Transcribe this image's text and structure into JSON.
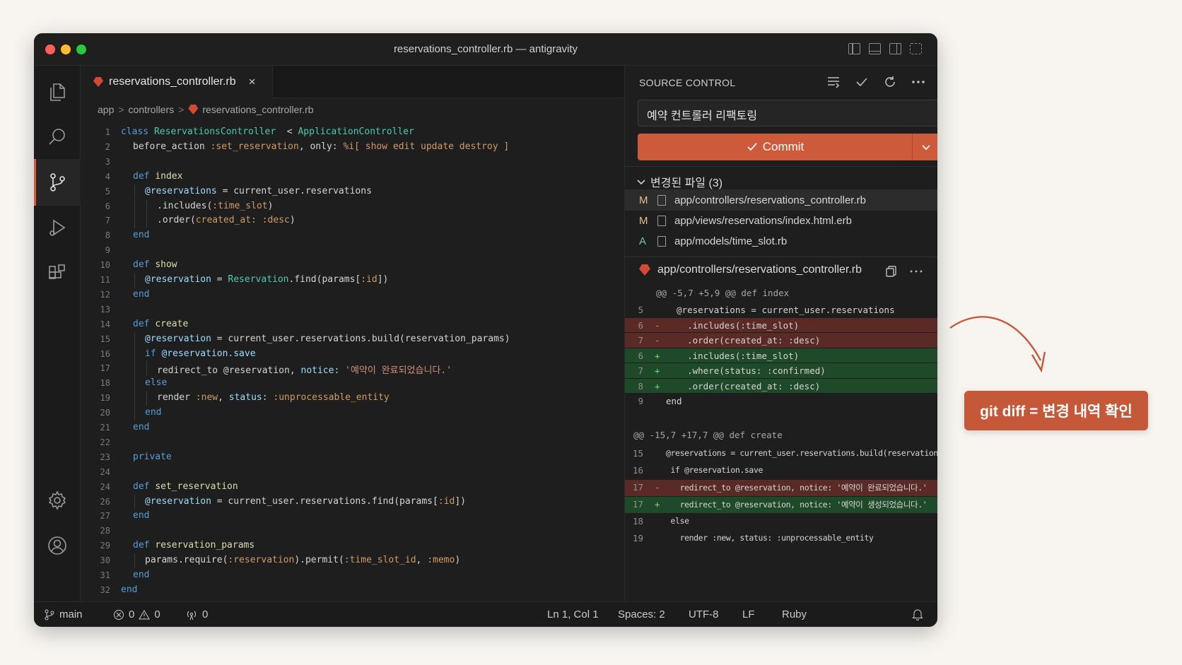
{
  "window": {
    "title": "reservations_controller.rb — antigravity"
  },
  "tab": {
    "label": "reservations_controller.rb",
    "close": "×"
  },
  "breadcrumb": {
    "parts": [
      "app",
      "controllers",
      "reservations_controller.rb"
    ],
    "sep": ">"
  },
  "editor": {
    "lines": [
      {
        "n": "1",
        "indent": 0,
        "tokens": [
          [
            "kw",
            "class "
          ],
          [
            "cls",
            "ReservationsController"
          ],
          [
            "",
            "  < "
          ],
          [
            "cls",
            "ApplicationController"
          ]
        ]
      },
      {
        "n": "2",
        "indent": 1,
        "tokens": [
          [
            "",
            "before_action "
          ],
          [
            "sym",
            ":set_reservation"
          ],
          [
            "",
            ", only: "
          ],
          [
            "sym",
            "%i[ show edit update destroy ]"
          ]
        ]
      },
      {
        "n": "3",
        "indent": 0,
        "tokens": []
      },
      {
        "n": "4",
        "indent": 1,
        "tokens": [
          [
            "kw",
            "def "
          ],
          [
            "fn",
            "index"
          ]
        ]
      },
      {
        "n": "5",
        "indent": 2,
        "tokens": [
          [
            "iv",
            "@reservations"
          ],
          [
            "",
            " = current_user.reservations"
          ]
        ]
      },
      {
        "n": "6",
        "indent": 3,
        "tokens": [
          [
            "",
            ".includes("
          ],
          [
            "sym",
            ":time_slot"
          ],
          [
            "",
            ")"
          ]
        ]
      },
      {
        "n": "7",
        "indent": 3,
        "tokens": [
          [
            "",
            ".order("
          ],
          [
            "sym",
            "created_at: :desc"
          ],
          [
            "",
            ")"
          ]
        ]
      },
      {
        "n": "8",
        "indent": 1,
        "tokens": [
          [
            "kw",
            "end"
          ]
        ]
      },
      {
        "n": "9",
        "indent": 0,
        "tokens": []
      },
      {
        "n": "10",
        "indent": 1,
        "tokens": [
          [
            "kw",
            "def "
          ],
          [
            "fn",
            "show"
          ]
        ]
      },
      {
        "n": "11",
        "indent": 2,
        "tokens": [
          [
            "iv",
            "@reservation"
          ],
          [
            "",
            " = "
          ],
          [
            "cls",
            "Reservation"
          ],
          [
            "",
            ".find(params["
          ],
          [
            "sym",
            ":id"
          ],
          [
            "",
            "])"
          ]
        ]
      },
      {
        "n": "12",
        "indent": 1,
        "tokens": [
          [
            "kw",
            "end"
          ]
        ]
      },
      {
        "n": "13",
        "indent": 0,
        "tokens": []
      },
      {
        "n": "14",
        "indent": 1,
        "tokens": [
          [
            "kw",
            "def "
          ],
          [
            "fn",
            "create"
          ]
        ]
      },
      {
        "n": "15",
        "indent": 2,
        "tokens": [
          [
            "iv",
            "@reservation"
          ],
          [
            "",
            " = current_user.reservations.build(reservation_params)"
          ]
        ]
      },
      {
        "n": "16",
        "indent": 2,
        "tokens": [
          [
            "kw",
            "if "
          ],
          [
            "iv",
            "@reservation.save"
          ]
        ]
      },
      {
        "n": "17",
        "indent": 3,
        "tokens": [
          [
            "",
            "redirect_to @reservation, "
          ],
          [
            "iv",
            "notice: "
          ],
          [
            "str",
            "'예약이 완료되었습니다.'"
          ]
        ]
      },
      {
        "n": "18",
        "indent": 2,
        "tokens": [
          [
            "kw",
            "else"
          ]
        ]
      },
      {
        "n": "19",
        "indent": 3,
        "tokens": [
          [
            "",
            "render "
          ],
          [
            "sym",
            ":new"
          ],
          [
            "",
            ", "
          ],
          [
            "iv",
            "status: "
          ],
          [
            "sym",
            ":unprocessable_entity"
          ]
        ]
      },
      {
        "n": "20",
        "indent": 2,
        "tokens": [
          [
            "kw",
            "end"
          ]
        ]
      },
      {
        "n": "21",
        "indent": 1,
        "tokens": [
          [
            "kw",
            "end"
          ]
        ]
      },
      {
        "n": "22",
        "indent": 0,
        "tokens": []
      },
      {
        "n": "23",
        "indent": 1,
        "tokens": [
          [
            "kw",
            "private"
          ]
        ]
      },
      {
        "n": "24",
        "indent": 0,
        "tokens": []
      },
      {
        "n": "24",
        "indent": 1,
        "tokens": [
          [
            "kw",
            "def "
          ],
          [
            "fn",
            "set_reservation"
          ]
        ]
      },
      {
        "n": "26",
        "indent": 2,
        "tokens": [
          [
            "iv",
            "@reservation"
          ],
          [
            "",
            " = current_user.reservations.find(params["
          ],
          [
            "sym",
            ":id"
          ],
          [
            "",
            "])"
          ]
        ]
      },
      {
        "n": "27",
        "indent": 1,
        "tokens": [
          [
            "kw",
            "end"
          ]
        ]
      },
      {
        "n": "28",
        "indent": 0,
        "tokens": []
      },
      {
        "n": "29",
        "indent": 1,
        "tokens": [
          [
            "kw",
            "def "
          ],
          [
            "fn",
            "reservation_params"
          ]
        ]
      },
      {
        "n": "30",
        "indent": 2,
        "tokens": [
          [
            "",
            "params.require("
          ],
          [
            "sym",
            ":reservation"
          ],
          [
            "",
            ").permit("
          ],
          [
            "sym",
            ":time_slot_id"
          ],
          [
            "",
            ", "
          ],
          [
            "sym",
            ":memo"
          ],
          [
            "",
            ")"
          ]
        ]
      },
      {
        "n": "31",
        "indent": 1,
        "tokens": [
          [
            "kw",
            "end"
          ]
        ]
      },
      {
        "n": "32",
        "indent": 0,
        "tokens": [
          [
            "kw",
            "end"
          ]
        ]
      }
    ]
  },
  "scm": {
    "title": "SOURCE CONTROL",
    "message": "예약 컨트롤러 리팩토링",
    "commit_label": "Commit",
    "changes_label": "변경된 파일 (3)",
    "files": [
      {
        "status": "M",
        "path": "app/controllers/reservations_controller.rb"
      },
      {
        "status": "M",
        "path": "app/views/reservations/index.html.erb"
      },
      {
        "status": "A",
        "path": "app/models/time_slot.rb"
      }
    ],
    "diff_file": "app/controllers/reservations_controller.rb",
    "hunk1": "@@ -5,7 +5,9 @@ def index",
    "diff1": [
      {
        "n": "5",
        "type": "ctx",
        "mark": "",
        "text": "  @reservations = current_user.reservations"
      },
      {
        "n": "6",
        "type": "del",
        "mark": "-",
        "text": "    .includes(:time_slot)"
      },
      {
        "n": "7",
        "type": "del",
        "mark": "-",
        "text": "    .order(created_at: :desc)"
      },
      {
        "n": "6",
        "type": "add",
        "mark": "+",
        "text": "    .includes(:time_slot)"
      },
      {
        "n": "7",
        "type": "add",
        "mark": "+",
        "text": "    .where(status: :confirmed)"
      },
      {
        "n": "8",
        "type": "add",
        "mark": "+",
        "text": "    .order(created_at: :desc)"
      },
      {
        "n": "9",
        "type": "ctx",
        "mark": "",
        "text": "end"
      }
    ],
    "hunk2": "@@ -15,7 +17,7 @@ def create",
    "diff2": [
      {
        "n": "15",
        "type": "ctx",
        "mark": "",
        "text": "@reservations = current_user.reservations.build(reservation_params)"
      },
      {
        "n": "16",
        "type": "ctx",
        "mark": "",
        "text": " if @reservation.save"
      },
      {
        "n": "17",
        "type": "del",
        "mark": "-",
        "text": "   redirect_to @reservation, notice: '예약이 완료되었습니다.'"
      },
      {
        "n": "17",
        "type": "add",
        "mark": "+",
        "text": "   redirect_to @reservation, notice: '예약이 생성되었습니다.'"
      },
      {
        "n": "18",
        "type": "ctx",
        "mark": "",
        "text": " else"
      },
      {
        "n": "19",
        "type": "ctx",
        "mark": "",
        "text": "   render :new, status: :unprocessable_entity"
      }
    ]
  },
  "statusbar": {
    "branch": "main",
    "errors": "0",
    "warnings": "0",
    "ports": "0",
    "position": "Ln 1, Col 1",
    "spaces": "Spaces: 2",
    "encoding": "UTF-8",
    "eol": "LF",
    "language": "Ruby"
  },
  "annotation": {
    "label": "git diff = 변경 내역 확인"
  }
}
